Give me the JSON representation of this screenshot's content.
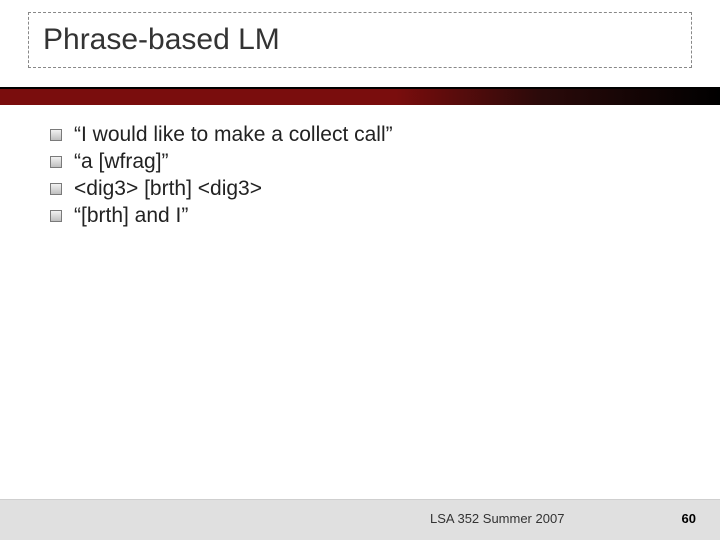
{
  "title": "Phrase-based LM",
  "bullets": [
    "“I would like to make a collect call”",
    "“a [wfrag]”",
    "<dig3> [brth] <dig3>",
    "“[brth] and I”"
  ],
  "footer": {
    "course": "LSA 352 Summer 2007",
    "page": "60"
  }
}
